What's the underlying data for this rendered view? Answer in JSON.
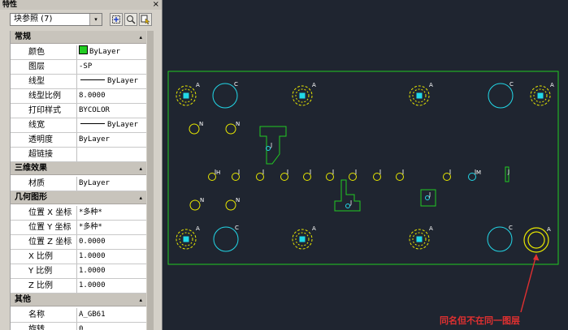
{
  "palette": {
    "title": "特性",
    "close_glyph": "×",
    "selection": "块参照 (7)",
    "dropdown_glyph": "▾",
    "collapse_glyph": "▴",
    "categories": [
      {
        "label": "常规",
        "rows": [
          {
            "name": "颜色",
            "value": "ByLayer",
            "kind": "color",
            "swatch": "#22cc22"
          },
          {
            "name": "图层",
            "value": "-SP"
          },
          {
            "name": "线型",
            "value": "ByLayer",
            "kind": "linetype"
          },
          {
            "name": "线型比例",
            "value": "8.0000"
          },
          {
            "name": "打印样式",
            "value": "BYCOLOR"
          },
          {
            "name": "线宽",
            "value": "ByLayer",
            "kind": "linetype"
          },
          {
            "name": "透明度",
            "value": "ByLayer"
          },
          {
            "name": "超链接",
            "value": ""
          }
        ]
      },
      {
        "label": "三维效果",
        "rows": [
          {
            "name": "材质",
            "value": "ByLayer"
          }
        ]
      },
      {
        "label": "几何图形",
        "rows": [
          {
            "name": "位置 X 坐标",
            "value": "*多种*"
          },
          {
            "name": "位置 Y 坐标",
            "value": "*多种*"
          },
          {
            "name": "位置 Z 坐标",
            "value": "0.0000"
          },
          {
            "name": "X 比例",
            "value": "1.0000"
          },
          {
            "name": "Y 比例",
            "value": "1.0000"
          },
          {
            "name": "Z 比例",
            "value": "1.0000"
          }
        ]
      },
      {
        "label": "其他",
        "rows": [
          {
            "name": "名称",
            "value": "A_GB61"
          },
          {
            "name": "旋转",
            "value": "0"
          }
        ]
      }
    ]
  },
  "drawing": {
    "note": "同名但不在同一图层",
    "labels": {
      "a": "A",
      "c": "C",
      "n": "N",
      "h": "H",
      "m": "M",
      "j": "J"
    },
    "colors": {
      "background": "#1f2530",
      "frame": "#22cc22",
      "yellow": "#e8e800",
      "cyan": "#22d8e8",
      "white": "#ffffff",
      "annotation": "#e03030"
    }
  }
}
